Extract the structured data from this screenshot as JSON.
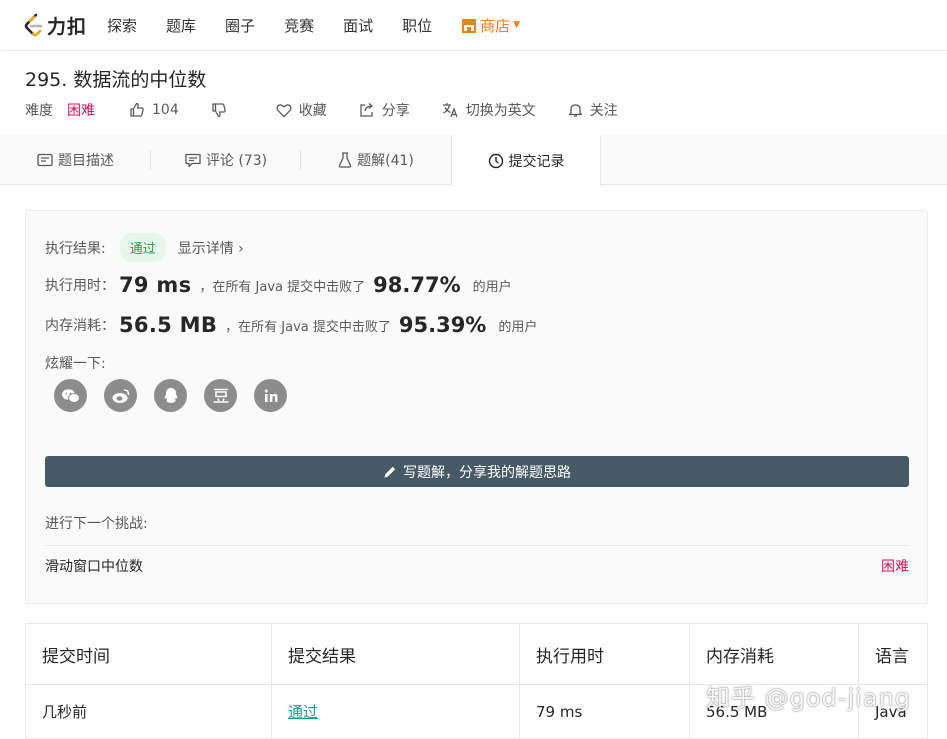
{
  "nav": {
    "logo_text": "力扣",
    "items": [
      {
        "label": "探索"
      },
      {
        "label": "题库"
      },
      {
        "label": "圈子"
      },
      {
        "label": "竞赛"
      },
      {
        "label": "面试"
      },
      {
        "label": "职位"
      }
    ],
    "shop_label": "商店",
    "shop_color": "#f0801c"
  },
  "problem": {
    "title": "295. 数据流的中位数",
    "difficulty_label": "难度",
    "difficulty": "困难",
    "difficulty_color": "#d4145a",
    "likes": "104",
    "favorite_label": "收藏",
    "share_label": "分享",
    "switch_lang_label": "切换为英文",
    "follow_label": "关注"
  },
  "tabs": [
    {
      "label": "题目描述",
      "icon": "description-icon"
    },
    {
      "label": "评论 (73)",
      "icon": "comment-icon"
    },
    {
      "label": "题解(41)",
      "icon": "flask-icon"
    },
    {
      "label": "提交记录",
      "icon": "clock-icon",
      "active": true
    }
  ],
  "result": {
    "status_label": "执行结果:",
    "status": "通过",
    "detail_link": "显示详情 ›",
    "time_label": "执行用时：",
    "time_value": "79 ms",
    "time_note": "，在所有 Java 提交中击败了",
    "time_pct": "98.77%",
    "time_suffix": "的用户",
    "mem_label": "内存消耗：",
    "mem_value": "56.5 MB",
    "mem_note": "，在所有 Java 提交中击败了",
    "mem_pct": "95.39%",
    "mem_suffix": "的用户",
    "share_label": "炫耀一下:",
    "share_icons": [
      "wechat-icon",
      "weibo-icon",
      "qq-icon",
      "douban-icon",
      "linkedin-icon"
    ],
    "write_button": "写题解，分享我的解题思路",
    "next_label": "进行下一个挑战:",
    "next_problem": "滑动窗口中位数",
    "next_difficulty": "困难"
  },
  "table": {
    "headers": [
      "提交时间",
      "提交结果",
      "执行用时",
      "内存消耗",
      "语言"
    ],
    "rows": [
      {
        "time": "几秒前",
        "result": "通过",
        "runtime": "79 ms",
        "memory": "56.5 MB",
        "language": "Java"
      }
    ]
  },
  "watermark": "知乎 @god-jiang"
}
